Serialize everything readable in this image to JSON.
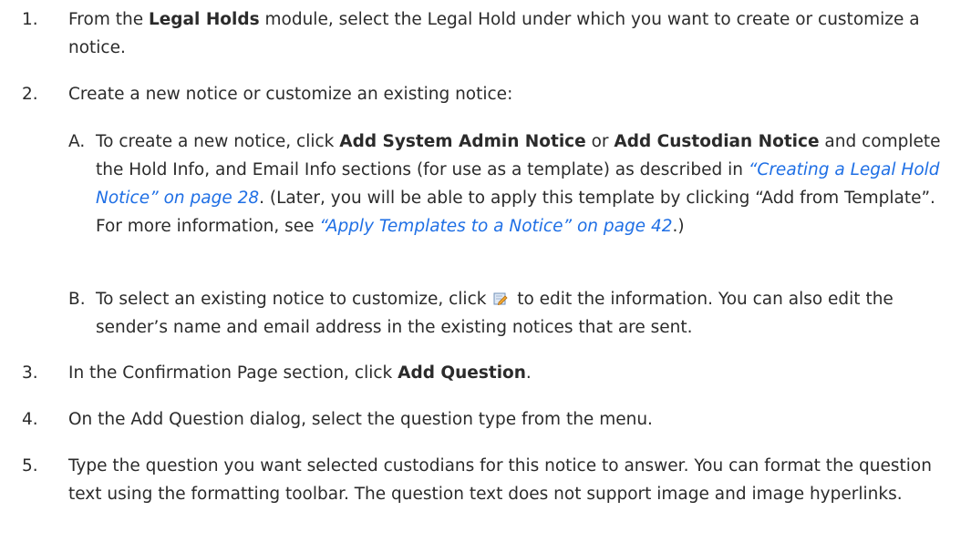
{
  "steps": [
    {
      "num": "1.",
      "t1": "From the ",
      "b1": "Legal Holds",
      "t2": " module, select the Legal Hold under which you want to create or customize a notice."
    },
    {
      "num": "2.",
      "t1": "Create a new notice or customize an existing notice:",
      "subs": [
        {
          "num": "A.",
          "t1": "To create a new notice, click ",
          "b1": "Add System Admin Notice",
          "t2": " or ",
          "b2": "Add Custodian Notice",
          "t3": " and complete the Hold Info, and Email Info sections (for use as a template) as described in ",
          "l1": "“Creating a Legal Hold Notice” on page 28",
          "t4": ". (Later, you will be able to apply this template by clicking “Add from Template”. For more information, see ",
          "l2": "“Apply Templates to a Notice” on page 42",
          "t5": ".)"
        },
        {
          "num": "B.",
          "t1": "To select an existing notice to customize, click ",
          "icon": "edit-icon",
          "t2": " to edit the information. You can also edit the sender’s name and email address in the existing notices that are sent."
        }
      ]
    },
    {
      "num": "3.",
      "t1": "In the Confirmation Page section, click ",
      "b1": "Add Question",
      "t2": "."
    },
    {
      "num": "4.",
      "t1": "On the Add Question dialog, select the question type from the menu."
    },
    {
      "num": "5.",
      "t1": "Type the question you want selected custodians for this notice to answer. You can format the question text using the formatting toolbar. The question text does not support image and image hyperlinks."
    }
  ],
  "colors": {
    "text": "#2b2b2b",
    "link": "#1f6fe5",
    "icon_paper": "#dfe9f5",
    "icon_pencil": "#f0a830"
  }
}
